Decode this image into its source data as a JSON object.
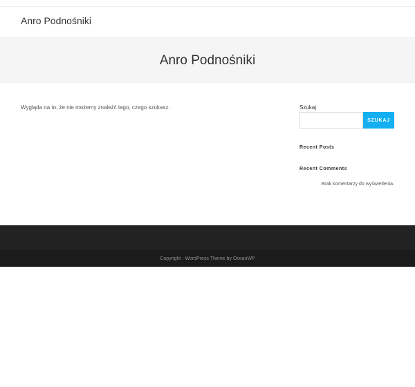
{
  "header": {
    "site_title": "Anro Podnośniki"
  },
  "page_header": {
    "title": "Anro Podnośniki"
  },
  "main": {
    "message": "Wygląda na to, że nie możemy znaleźć tego, czego szukasz."
  },
  "sidebar": {
    "search_title": "Szukaj",
    "search_value": "",
    "search_button_label": "SZUKAJ",
    "recent_posts_title": "Recent Posts",
    "recent_comments_title": "Recent Comments",
    "no_comments_text": "Brak komentarzy do wyświetlenia."
  },
  "footer": {
    "copyright": "Copyright - WordPress Theme by OceanWP"
  },
  "colors": {
    "accent": "#13aff0",
    "footer_bg": "#222222",
    "footer_bottom_bg": "#1b1b1b",
    "page_header_bg": "#f5f5f5"
  }
}
